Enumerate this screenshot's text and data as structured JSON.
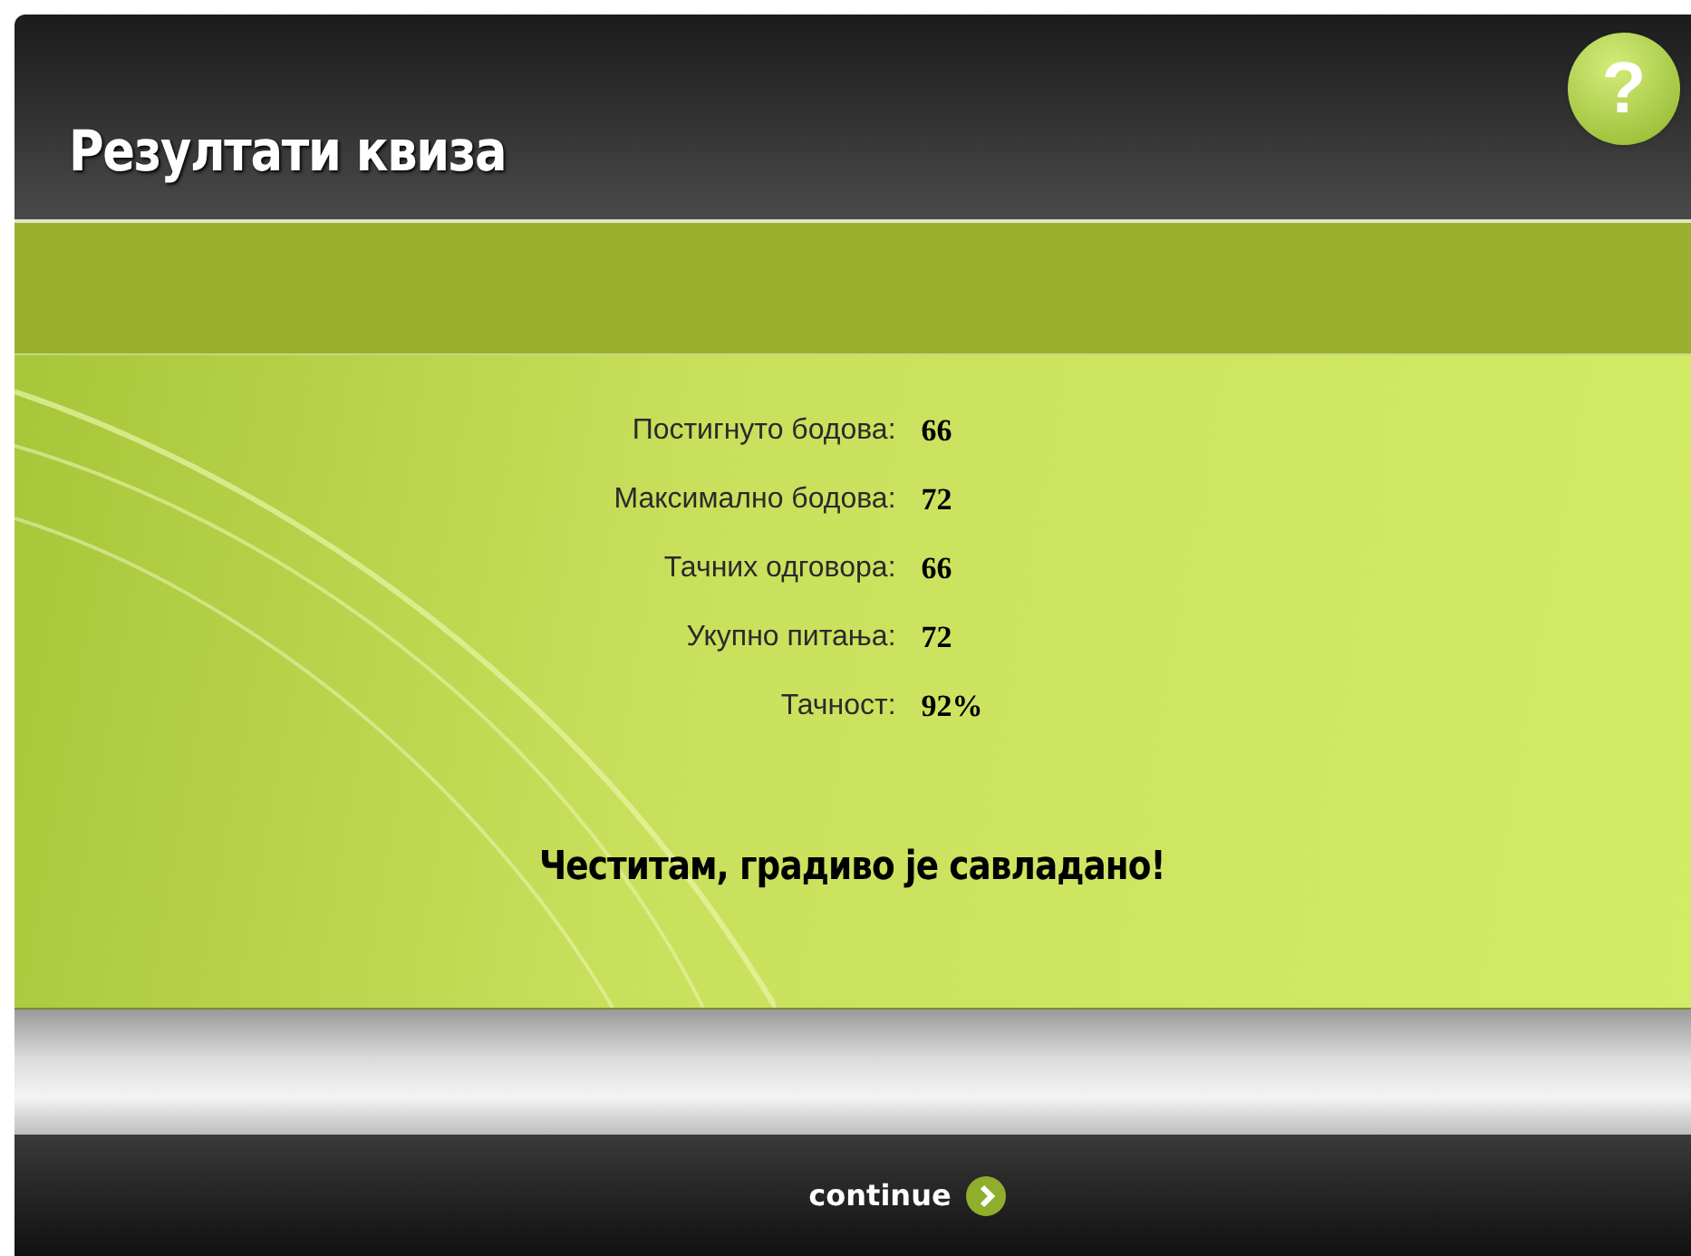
{
  "header": {
    "title": "Резултати квиза",
    "help_label": "?"
  },
  "results": [
    {
      "label": "Постигнуто бодова:",
      "value": "66"
    },
    {
      "label": "Максимално бодова:",
      "value": "72"
    },
    {
      "label": "Тачних одговора:",
      "value": "66"
    },
    {
      "label": "Укупно питања:",
      "value": "72"
    },
    {
      "label": "Тачност:",
      "value": "92%"
    }
  ],
  "message": "Честитам, градиво је савладано!",
  "footer": {
    "continue_label": "continue"
  }
}
